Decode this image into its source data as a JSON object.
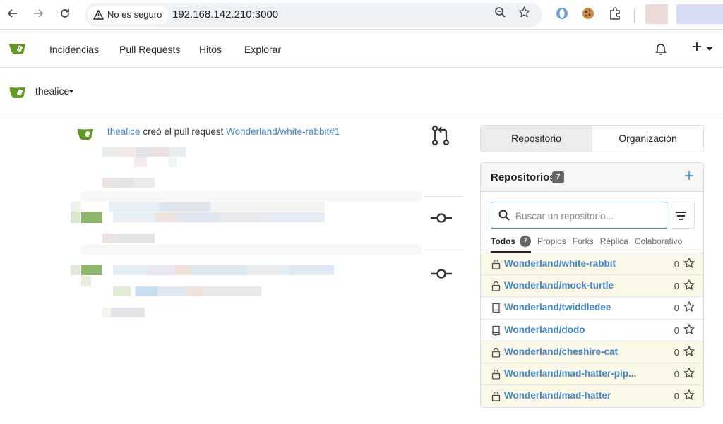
{
  "browser": {
    "security_label": "No es seguro",
    "url": "192.168.142.210:3000"
  },
  "nav": {
    "items": [
      "Incidencias",
      "Pull Requests",
      "Hitos",
      "Explorar"
    ]
  },
  "context": {
    "username": "thealice"
  },
  "feed": {
    "actor": "thealice",
    "action": "creó el pull request",
    "target": "Wonderland/white-rabbit#1"
  },
  "dashboard": {
    "tabs": [
      "Repositorio",
      "Organización"
    ],
    "repos_title": "Repositorios",
    "repos_count": "7",
    "search_placeholder": "Buscar un repositorio...",
    "subtabs": [
      "Todos",
      "Propios",
      "Forks",
      "Réplica",
      "Colaborativo"
    ],
    "subtab_count": "7",
    "repos": [
      {
        "name": "Wonderland/white-rabbit",
        "stars": "0",
        "private": true
      },
      {
        "name": "Wonderland/mock-turtle",
        "stars": "0",
        "private": true
      },
      {
        "name": "Wonderland/twiddledee",
        "stars": "0",
        "private": false
      },
      {
        "name": "Wonderland/dodo",
        "stars": "0",
        "private": false
      },
      {
        "name": "Wonderland/cheshire-cat",
        "stars": "0",
        "private": true
      },
      {
        "name": "Wonderland/mad-hatter-pip...",
        "stars": "0",
        "private": true
      },
      {
        "name": "Wonderland/mad-hatter",
        "stars": "0",
        "private": true
      }
    ]
  },
  "colors": {
    "link": "#4183c4",
    "brand_green": "#609926",
    "private_row": "#fbf8e8"
  }
}
